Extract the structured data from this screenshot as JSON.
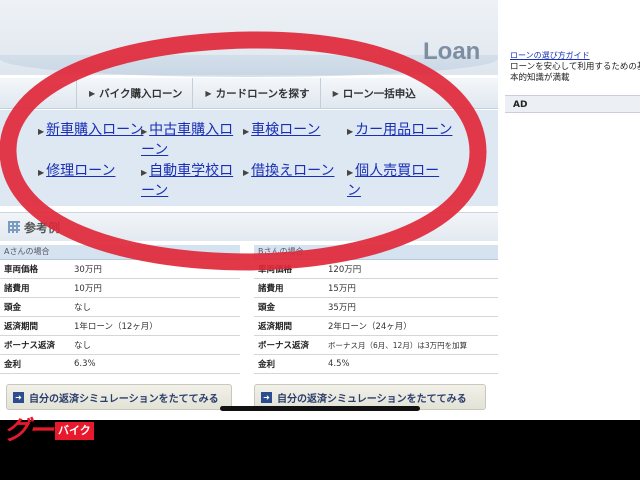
{
  "banner": {
    "word": "Loan"
  },
  "nav": {
    "items": [
      {
        "label": "バイク購入ローン"
      },
      {
        "label": "カードローンを探す"
      },
      {
        "label": "ローン一括申込"
      }
    ]
  },
  "categories": [
    {
      "label": "新車購入ローン"
    },
    {
      "label": "中古車購入ローン"
    },
    {
      "label": "車検ローン"
    },
    {
      "label": "カー用品ローン"
    },
    {
      "label": "修理ローン"
    },
    {
      "label": "自動車学校ローン"
    },
    {
      "label": "借換えローン"
    },
    {
      "label": "個人売買ローン"
    }
  ],
  "sidebar": {
    "link_text": "ローンの選び方ガイド",
    "text_lines": [
      "ローンを安心して利用するための基",
      "本的知識が満載"
    ],
    "ad_label": "AD"
  },
  "reference": {
    "title": "参考例"
  },
  "case_a": {
    "header": "Aさんの場合",
    "rows": [
      {
        "k": "車両価格",
        "v": "30万円"
      },
      {
        "k": "諸費用",
        "v": "10万円"
      },
      {
        "k": "頭金",
        "v": "なし"
      },
      {
        "k": "返済期間",
        "v": "1年ローン（12ヶ月）"
      },
      {
        "k": "ボーナス返済",
        "v": "なし"
      },
      {
        "k": "金利",
        "v": "6.3%"
      }
    ],
    "sim_label": "自分の返済シミュレーションをたててみる"
  },
  "case_b": {
    "header": "Bさんの場合",
    "rows": [
      {
        "k": "車両価格",
        "v": "120万円"
      },
      {
        "k": "諸費用",
        "v": "15万円"
      },
      {
        "k": "頭金",
        "v": "35万円"
      },
      {
        "k": "返済期間",
        "v": "2年ローン（24ヶ月）"
      },
      {
        "k": "ボーナス返済",
        "v": "ボーナス月（6月、12月）は3万円を加算"
      },
      {
        "k": "金利",
        "v": "4.5%"
      }
    ],
    "sim_label": "自分の返済シミュレーションをたててみる"
  },
  "logo": {
    "mark": "グー",
    "badge": "バイク"
  },
  "colors": {
    "circle": "#e0283a",
    "link": "#1a2fb5",
    "logo": "#e8192c"
  }
}
